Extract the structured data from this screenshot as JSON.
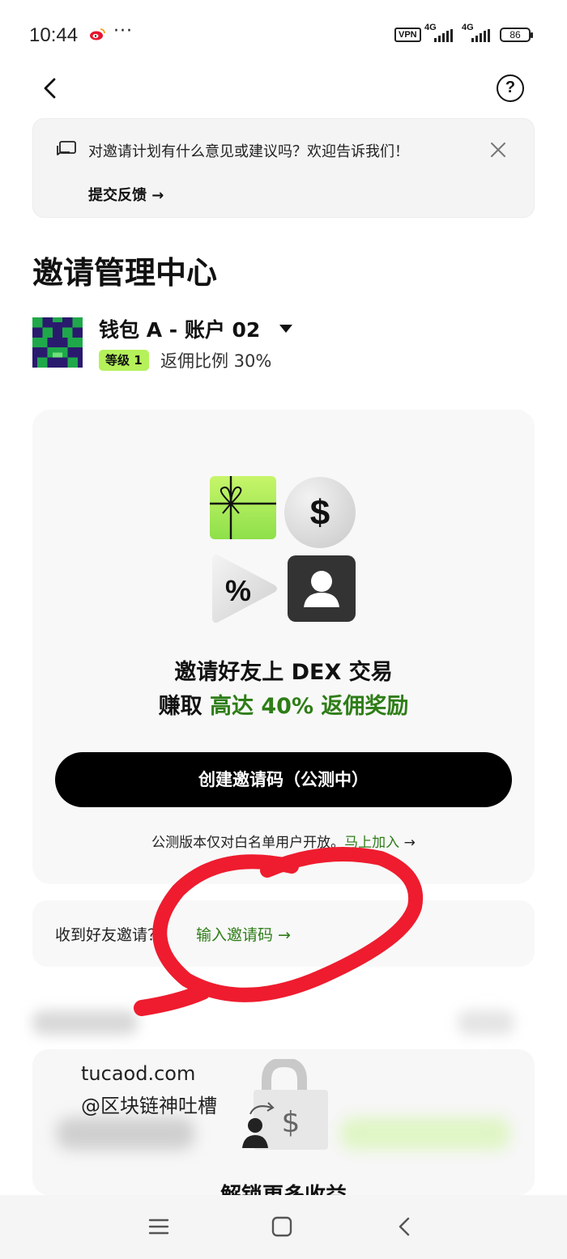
{
  "status_bar": {
    "time": "10:44",
    "dots": "···",
    "vpn": "VPN",
    "sim1": "4G",
    "sim2": "4G",
    "battery": "86"
  },
  "banner": {
    "message": "对邀请计划有什么意见或建议吗？欢迎告诉我们！",
    "submit_label": "提交反馈 →"
  },
  "page_title": "邀请管理中心",
  "account": {
    "name": "钱包 A - 账户 02",
    "level": "等级 1",
    "rebate": "返佣比例 30%"
  },
  "promo": {
    "headline_line1": "邀请好友上 DEX 交易",
    "headline_line2_prefix": "赚取",
    "headline_line2_highlight": "高达 40% 返佣奖励",
    "create_button": "创建邀请码（公测中）",
    "whitelist_text": "公测版本仅对白名单用户开放。",
    "join_link": "马上加入",
    "join_arrow": "→"
  },
  "invite": {
    "question": "收到好友邀请？",
    "enter_link": "输入邀请码 →"
  },
  "unlock_title": "解锁更多收益",
  "watermark": {
    "site": "tucaod.com",
    "handle": "@区块链神吐槽"
  },
  "colors": {
    "accent_green": "#2e7d17",
    "badge_lime": "#b5f15a",
    "scribble_red": "#ee1c2e"
  }
}
